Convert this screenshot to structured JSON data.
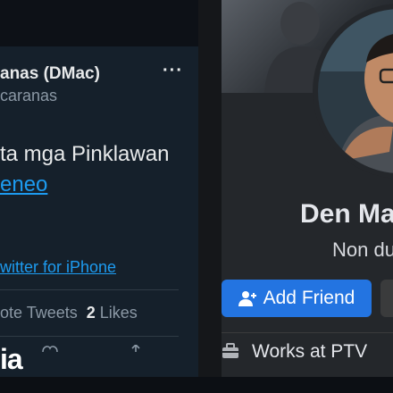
{
  "tweet": {
    "author_name": "anas (DMac)",
    "handle": "caranas",
    "more": "···",
    "body_line1": "ta mga Pinklawan",
    "body_line2": "eneo",
    "source": "witter for iPhone",
    "stats_prefix": "ote Tweets",
    "likes_count": "2",
    "likes_label": "Likes",
    "watermark": "ia"
  },
  "profile": {
    "name": "Den Ma",
    "subtitle": "Non du",
    "add_friend_label": "Add Friend",
    "work_text": "Works at PTV"
  },
  "colors": {
    "tweet_bg": "#15202b",
    "tweet_link": "#1d9bf0",
    "fb_bg": "#24272b",
    "fb_button": "#2374e1"
  }
}
